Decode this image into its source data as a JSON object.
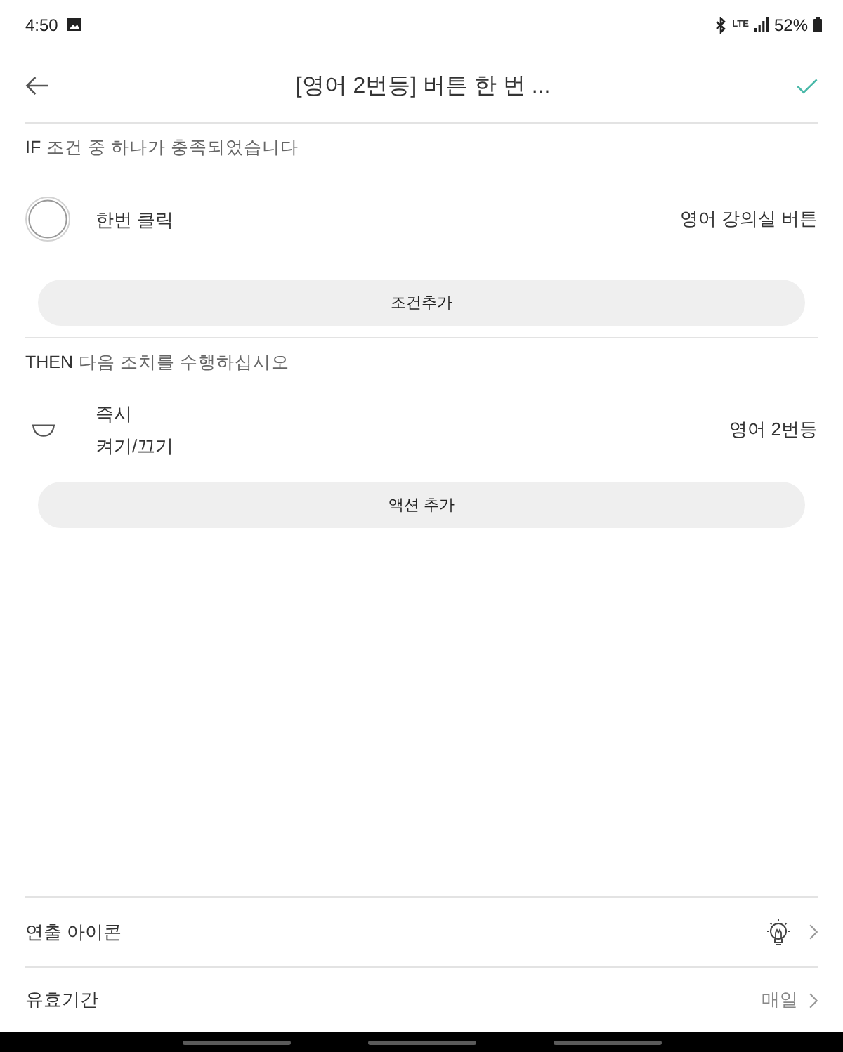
{
  "status_bar": {
    "time": "4:50",
    "network": "LTE",
    "battery": "52%"
  },
  "header": {
    "title": "[영어 2번등] 버튼 한 번 ..."
  },
  "sections": [
    {
      "keyword": "IF",
      "heading": "조건 중 하나가 충족되었습니다",
      "items": [
        {
          "kind": "condition",
          "label": "한번 클릭",
          "device": "영어 강의실 버튼"
        }
      ],
      "add_button": "조건추가"
    },
    {
      "keyword": "THEN",
      "heading": "다음 조치를 수행하십시오",
      "items": [
        {
          "kind": "action",
          "timing": "즉시",
          "label": "켜기/끄기",
          "device": "영어 2번등"
        }
      ],
      "add_button": "액션 추가"
    }
  ],
  "settings": [
    {
      "kind": "icon",
      "label": "연출 아이콘"
    },
    {
      "kind": "value",
      "label": "유효기간",
      "value": "매일"
    }
  ]
}
